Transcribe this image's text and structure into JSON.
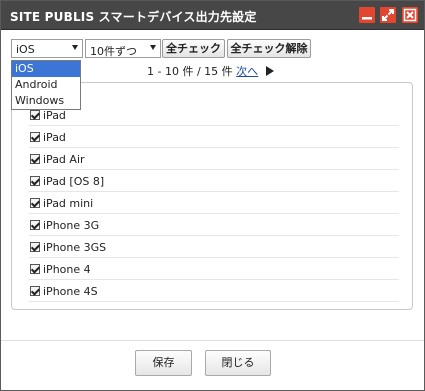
{
  "window": {
    "title": "SITE PUBLIS スマートデバイス出力先設定"
  },
  "titlebar_buttons": {
    "minimize": "minimize-icon",
    "maximize": "expand-icon",
    "close": "close-icon",
    "accent": "#e2462f"
  },
  "toolbar": {
    "os_select": {
      "value": "iOS",
      "options": [
        "iOS",
        "Android",
        "Windows"
      ]
    },
    "per_page_select": {
      "value": "10件ずつ"
    },
    "check_all_label": "全チェック",
    "uncheck_all_label": "全チェック解除"
  },
  "pagination": {
    "range": "1 - 10 件 / 15 件",
    "next_label": "次へ"
  },
  "devices": [
    {
      "label": "iPad",
      "checked": true
    },
    {
      "label": "iPad",
      "checked": true
    },
    {
      "label": "iPad Air",
      "checked": true
    },
    {
      "label": "iPad [OS 8]",
      "checked": true
    },
    {
      "label": "iPad mini",
      "checked": true
    },
    {
      "label": "iPhone 3G",
      "checked": true
    },
    {
      "label": "iPhone 3GS",
      "checked": true
    },
    {
      "label": "iPhone 4",
      "checked": true
    },
    {
      "label": "iPhone 4S",
      "checked": true
    }
  ],
  "footer": {
    "save_label": "保存",
    "close_label": "閉じる"
  },
  "colors": {
    "titlebar": "#474747",
    "selected_option": "#3b75d6",
    "link": "#1a4d9e"
  }
}
